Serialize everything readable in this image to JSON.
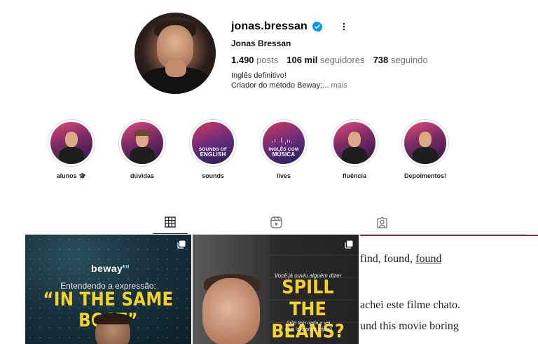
{
  "profile": {
    "username": "jonas.bressan",
    "full_name": "Jonas Bressan",
    "posts_count": "1.490",
    "posts_label": "posts",
    "followers_count": "106 mil",
    "followers_label": "seguidores",
    "following_count": "738",
    "following_label": "seguindo",
    "bio_line1": "Inglês definitivo!",
    "bio_line2": "Criador do método Beway;...",
    "bio_more": "mais"
  },
  "highlights": [
    {
      "label": "alunos 🎓"
    },
    {
      "label": "dúvidas"
    },
    {
      "label": "sounds",
      "cover_text_1": "SOUNDS OF",
      "cover_text_2": "ENGLISH"
    },
    {
      "label": "lives",
      "cover_text_1": "INGLÊS COM",
      "cover_text_2": "MÚSICA"
    },
    {
      "label": "fluência"
    },
    {
      "label": "Depoimentos!"
    }
  ],
  "tabs": [
    {
      "name": "posts",
      "icon": "grid-icon",
      "active": true
    },
    {
      "name": "reels",
      "icon": "reels-icon",
      "active": false
    },
    {
      "name": "tagged",
      "icon": "tagged-icon",
      "active": false
    }
  ],
  "posts": [
    {
      "brand": "beway",
      "brand_sup": "EN",
      "subtitle": "Entendendo a expressão:",
      "title": "“IN THE SAME BOAT”"
    },
    {
      "question": "Você já ouviu alguém dizer",
      "title_line1": "SPILL THE",
      "title_line2": "BEANS?",
      "small_line1": "(não tem nada a ver",
      "small_line2": "com 'derramar feijão')"
    },
    {
      "line1_prefix": "find, found, ",
      "line1_underlined": "found",
      "line2": "achei este filme chato.",
      "line3": "und this movie boring"
    }
  ],
  "colors": {
    "verified": "#0095f6",
    "text_primary": "#262626",
    "text_secondary": "#737373",
    "post_title_yellow": "#f5d22b"
  }
}
